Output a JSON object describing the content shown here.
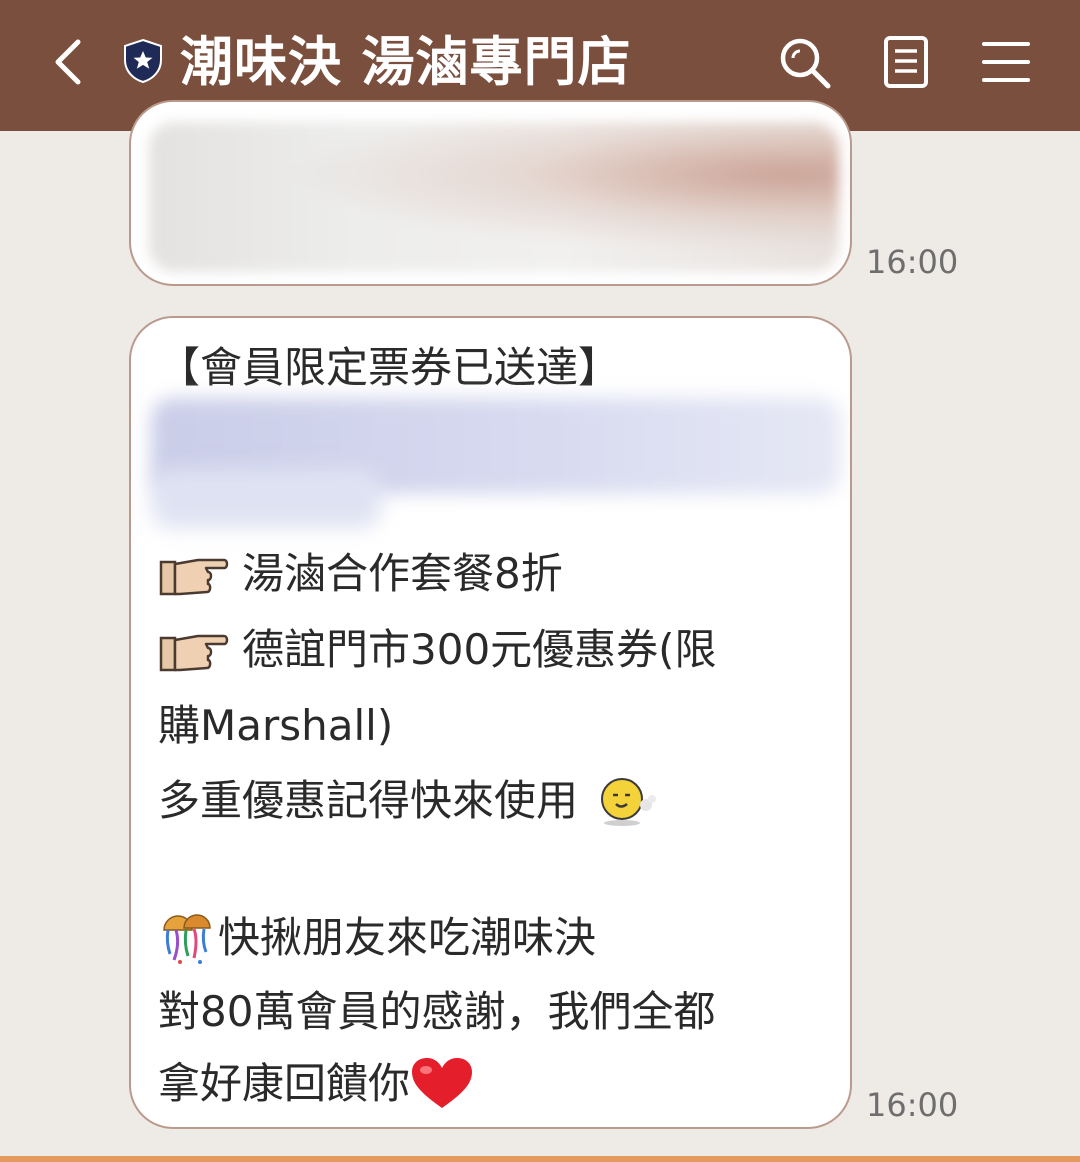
{
  "header": {
    "title": "潮味決 湯滷專門店",
    "back_icon": "chevron-left-icon",
    "badge_icon": "verified-shield-icon",
    "search_icon": "search-icon",
    "notes_icon": "notes-icon",
    "menu_icon": "hamburger-menu-icon",
    "background": "#7a4f3d"
  },
  "messages": [
    {
      "type": "image",
      "time": "16:00"
    },
    {
      "type": "text",
      "time": "16:00",
      "lines": {
        "title": "【會員限定票券已送達】",
        "offer1": "湯滷合作套餐8折",
        "offer2a": "德誼門市300元優惠券(限",
        "offer2b": "購Marshall)",
        "remind": "多重優惠記得快來使用",
        "invite": "快揪朋友來吃潮味決",
        "thanks": "對80萬會員的感謝，我們全都",
        "gift": "拿好康回饋你"
      },
      "emojis": [
        "pointing-hand-icon",
        "smiling-face-sticker-icon",
        "confetti-ball-icon",
        "red-heart-icon"
      ]
    }
  ],
  "colors": {
    "chat_background": "#eeebe7",
    "bubble_border": "#b99a8c",
    "timestamp": "#6e6e6e",
    "bottom_strip": "#e39a5f"
  }
}
